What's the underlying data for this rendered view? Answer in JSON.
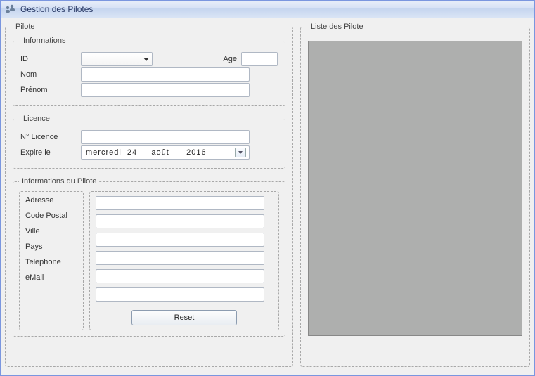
{
  "window": {
    "title": "Gestion des Pilotes"
  },
  "pilote": {
    "legend": "Pilote",
    "informations": {
      "legend": "Informations",
      "labels": {
        "id": "ID",
        "age": "Age",
        "nom": "Nom",
        "prenom": "Prénom"
      },
      "values": {
        "id": "",
        "age": "",
        "nom": "",
        "prenom": ""
      }
    },
    "licence": {
      "legend": "Licence",
      "labels": {
        "num": "N° Licence",
        "expire": "Expire le"
      },
      "values": {
        "num": "",
        "expire": "mercredi  24     août      2016"
      }
    },
    "details": {
      "legend": "Informations du Pilote",
      "labels": {
        "adresse": "Adresse",
        "cp": "Code Postal",
        "ville": "Ville",
        "pays": "Pays",
        "tel": "Telephone",
        "email": "eMail"
      },
      "values": {
        "adresse": "",
        "cp": "",
        "ville": "",
        "pays": "",
        "tel": "",
        "email": ""
      },
      "reset": "Reset"
    }
  },
  "liste": {
    "legend": "Liste des Pilote"
  }
}
